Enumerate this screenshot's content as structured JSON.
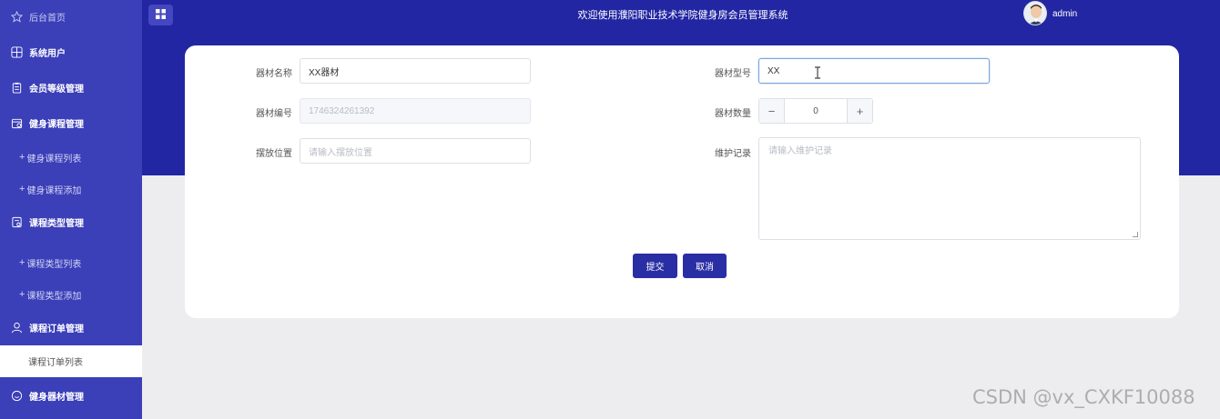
{
  "sidebar": {
    "items": [
      {
        "label": "后台首页",
        "icon": "star-icon"
      },
      {
        "label": "系统用户",
        "icon": "grid-icon"
      },
      {
        "label": "会员等级管理",
        "icon": "clipboard-icon"
      },
      {
        "label": "健身课程管理",
        "icon": "calendar-icon"
      },
      {
        "label": "健身课程列表",
        "icon": "plus-icon"
      },
      {
        "label": "健身课程添加",
        "icon": "plus-icon"
      },
      {
        "label": "课程类型管理",
        "icon": "document-icon"
      },
      {
        "label": "课程类型列表",
        "icon": "plus-icon"
      },
      {
        "label": "课程类型添加",
        "icon": "plus-icon"
      },
      {
        "label": "课程订单管理",
        "icon": "user-icon"
      },
      {
        "label": "课程订单列表",
        "icon": ""
      },
      {
        "label": "健身器材管理",
        "icon": "chat-icon"
      }
    ],
    "plus_glyph": "+"
  },
  "header": {
    "title": "欢迎使用濮阳职业技术学院健身房会员管理系统",
    "username": "admin"
  },
  "form": {
    "name_label": "器材名称",
    "name_value": "XX器材",
    "model_label": "器材型号",
    "model_value": "XX",
    "code_label": "器材编号",
    "code_value": "1746324261392",
    "qty_label": "器材数量",
    "qty_value": "0",
    "qty_minus": "−",
    "qty_plus": "+",
    "location_label": "摆放位置",
    "location_placeholder": "请输入摆放位置",
    "maintenance_label": "维护记录",
    "maintenance_placeholder": "请输入维护记录",
    "submit_label": "提交",
    "cancel_label": "取消"
  },
  "watermark": "CSDN @vx_CXKF10088",
  "colors": {
    "sidebar": "#3b3fb8",
    "header": "#2226a2",
    "button": "#2a2ea5"
  }
}
